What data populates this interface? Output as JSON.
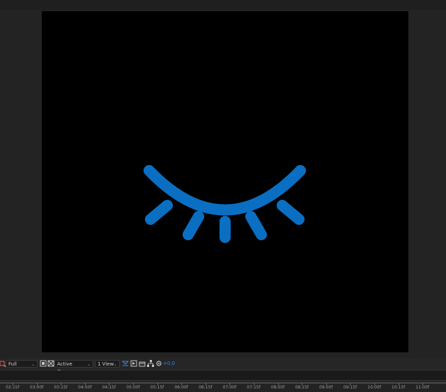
{
  "composition": {
    "background": "#000000",
    "icon_name": "closed-eye-icon",
    "icon_color": "#0a6fc2"
  },
  "toolbar": {
    "resolution": "Full",
    "camera": "Active Camera",
    "views": "1 View",
    "exposure": "+0,0"
  },
  "timeline": {
    "ticks": [
      "02:15f",
      "03:00f",
      "03:15f",
      "04:00f",
      "04:15f",
      "05:00f",
      "05:15f",
      "06:00f",
      "06:15f",
      "07:00f",
      "07:15f",
      "08:00f",
      "08:15f",
      "09:00f",
      "09:15f",
      "10:00f",
      "10:15f",
      "11:00f"
    ]
  }
}
